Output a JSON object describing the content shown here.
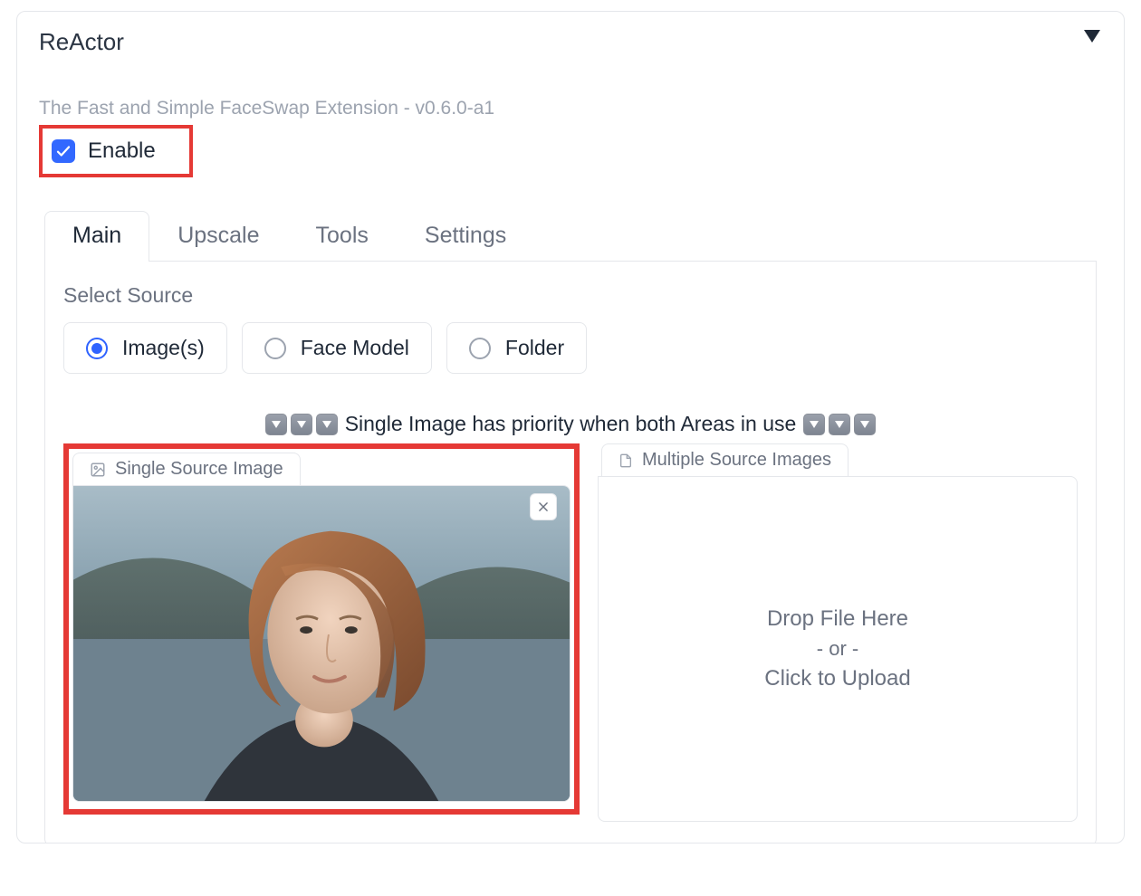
{
  "panel": {
    "title": "ReActor",
    "subtitle": "The Fast and Simple FaceSwap Extension - v0.6.0-a1",
    "enable_label": "Enable",
    "enable_checked": true
  },
  "tabs": [
    "Main",
    "Upscale",
    "Tools",
    "Settings"
  ],
  "active_tab": "Main",
  "source": {
    "section_label": "Select Source",
    "options": [
      "Image(s)",
      "Face Model",
      "Folder"
    ],
    "selected": "Image(s)"
  },
  "priority_notice": "Single Image has priority when both Areas in use",
  "single_source": {
    "tab_label": "Single Source Image",
    "has_image": true
  },
  "multi_source": {
    "tab_label": "Multiple Source Images",
    "drop_line1": "Drop File Here",
    "drop_line2": "- or -",
    "drop_line3": "Click to Upload"
  }
}
